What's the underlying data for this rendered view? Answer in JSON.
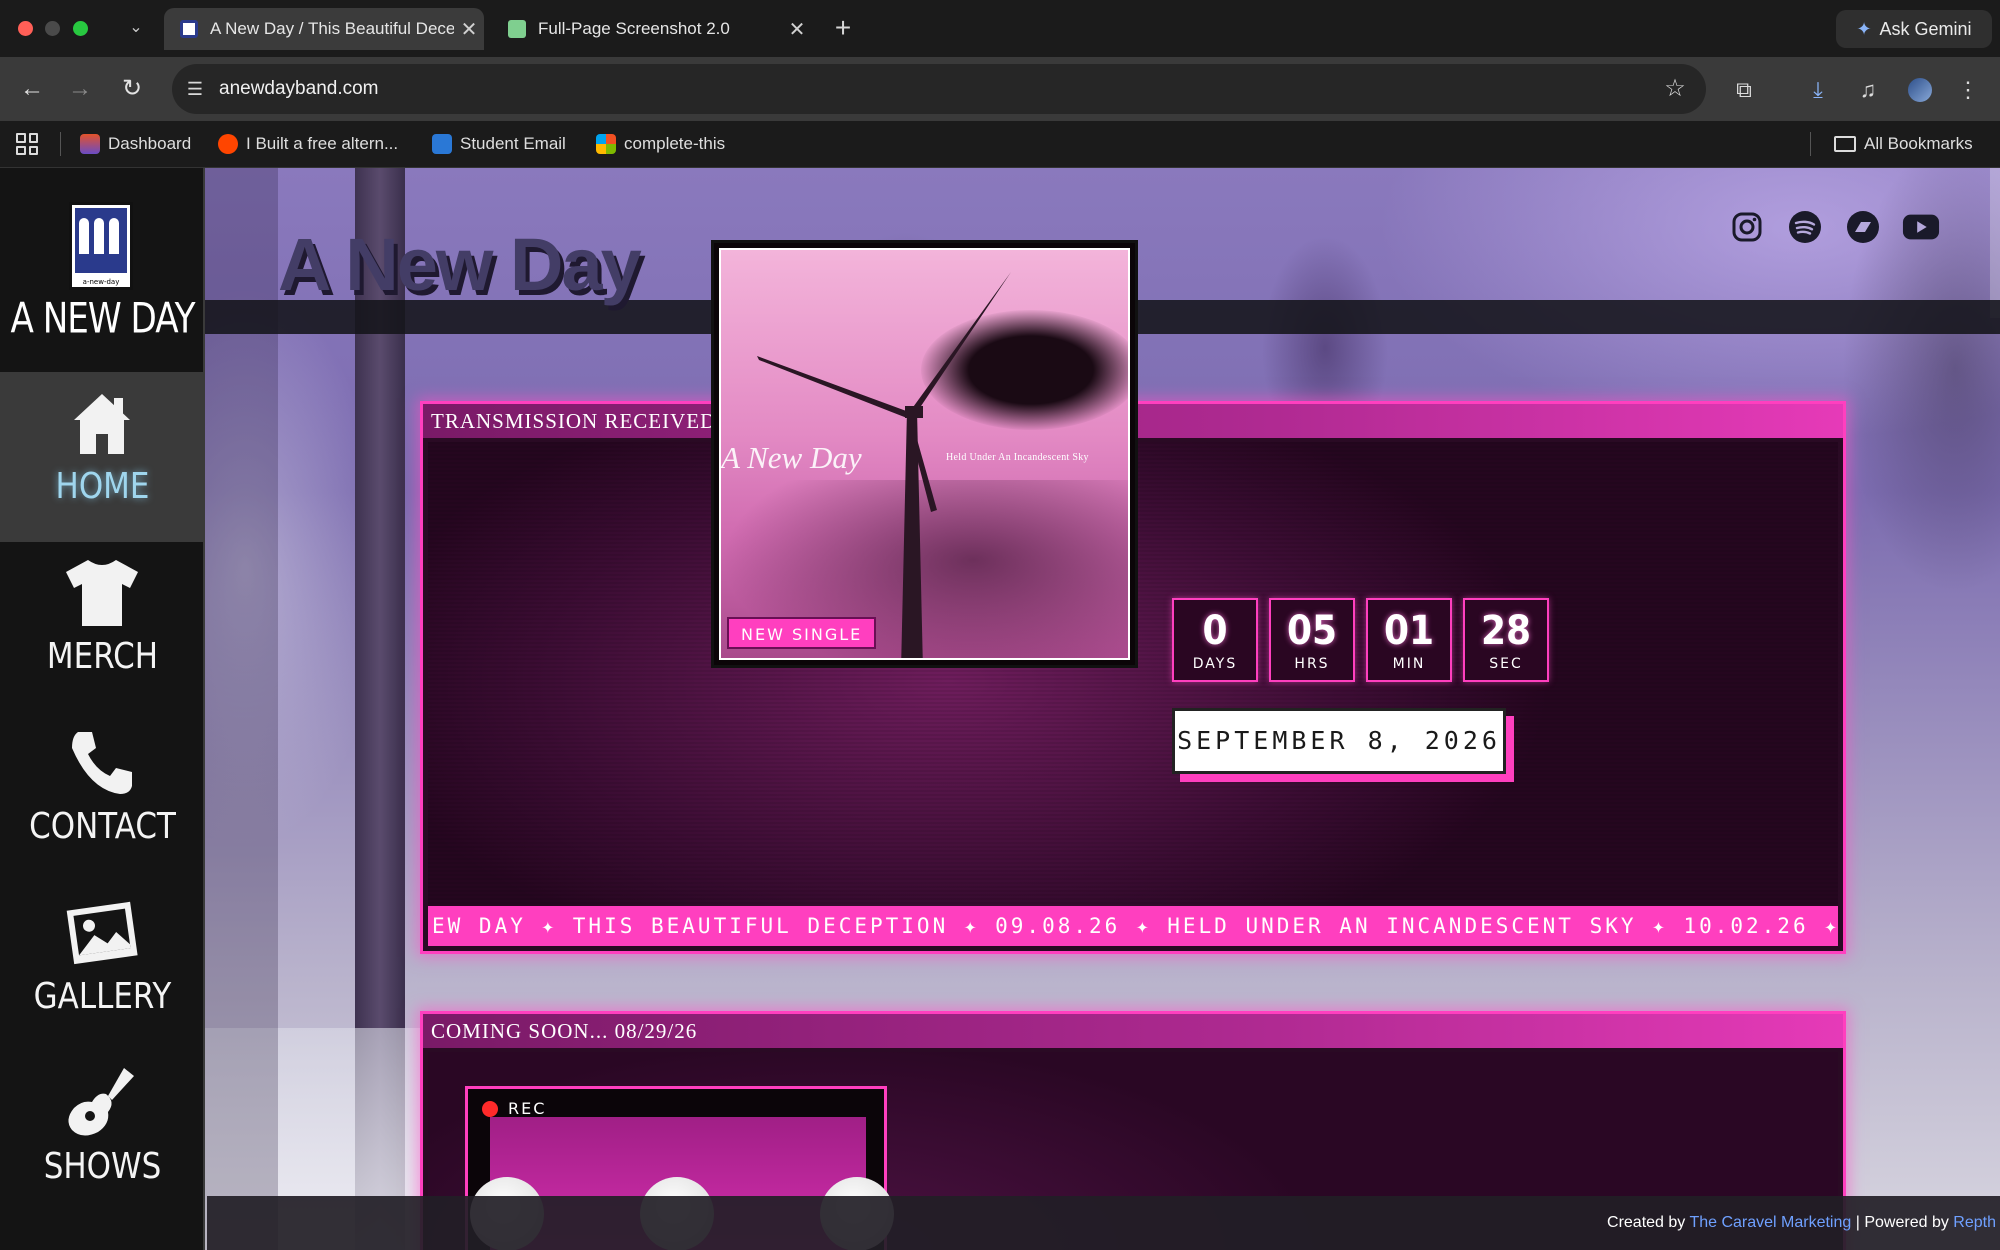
{
  "browser": {
    "tabs": [
      {
        "title": "A New Day / This Beautiful Deception",
        "active": true
      },
      {
        "title": "Full-Page Screenshot 2.0",
        "active": false
      }
    ],
    "ask_gemini": "Ask Gemini",
    "url": "anewdayband.com",
    "bookmarks": [
      {
        "label": "Dashboard"
      },
      {
        "label": "I Built a free altern..."
      },
      {
        "label": "Student Email"
      },
      {
        "label": "complete-this"
      }
    ],
    "all_bookmarks": "All Bookmarks"
  },
  "site": {
    "band_name": "A NEW DAY",
    "logo_caption": "a-new-day",
    "title": "A New Day",
    "nav": [
      {
        "label": "HOME",
        "icon": "home-icon",
        "active": true
      },
      {
        "label": "MERCH",
        "icon": "tshirt-icon",
        "active": false
      },
      {
        "label": "CONTACT",
        "icon": "phone-icon",
        "active": false
      },
      {
        "label": "GALLERY",
        "icon": "image-icon",
        "active": false
      },
      {
        "label": "SHOWS",
        "icon": "guitar-icon",
        "active": false
      }
    ],
    "social": [
      "instagram-icon",
      "spotify-icon",
      "bandcamp-icon",
      "youtube-icon"
    ]
  },
  "release": {
    "header": "TRANSMISSION RECEIVED... 09/08/26",
    "cover_text": "A New Day",
    "cover_subtitle": "Held Under An Incandescent Sky",
    "badge": "NEW SINGLE",
    "countdown": [
      {
        "value": "0",
        "unit": "DAYS"
      },
      {
        "value": "05",
        "unit": "HRS"
      },
      {
        "value": "01",
        "unit": "MIN"
      },
      {
        "value": "28",
        "unit": "SEC"
      }
    ],
    "date": "SEPTEMBER 8, 2026",
    "ticker": "EW DAY ✦ THIS BEAUTIFUL DECEPTION ✦ 09.08.26 ✦ HELD UNDER AN INCANDESCENT SKY ✦ 10.02.26 ✦ A NEW DAY ✦ THI"
  },
  "coming_soon": {
    "header": "COMING SOON... 08/29/26",
    "rec": "REC"
  },
  "footer": {
    "created_by": "Created by",
    "agency": "The Caravel Marketing",
    "separator": "|",
    "powered_by": "Powered by",
    "platform": "Repth"
  },
  "colors": {
    "accent": "#ff3fbf",
    "sidebar_bg": "#141414",
    "active_nav_text": "#9fd6ee"
  }
}
